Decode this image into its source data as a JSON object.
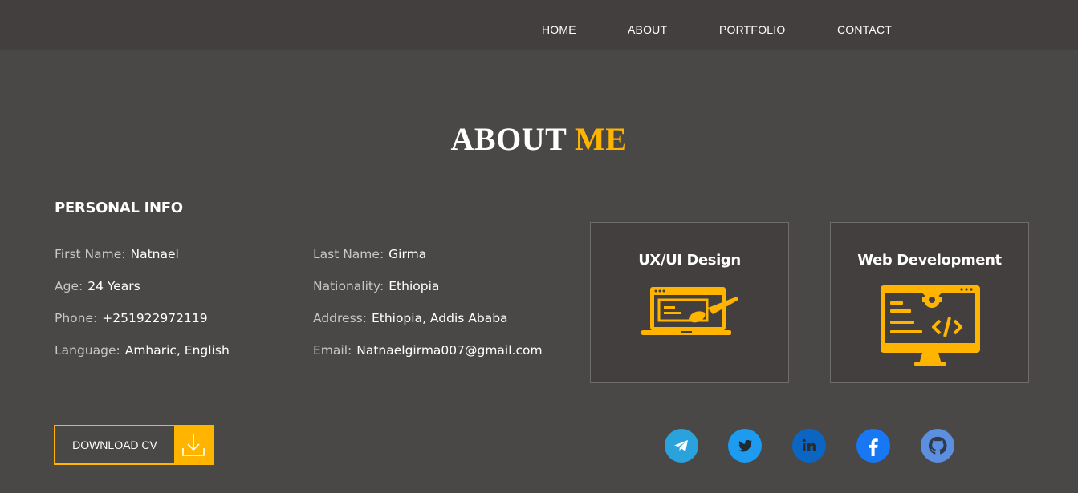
{
  "nav": {
    "items": [
      {
        "label": "HOME"
      },
      {
        "label": "ABOUT"
      },
      {
        "label": "PORTFOLIO"
      },
      {
        "label": "CONTACT"
      }
    ]
  },
  "about": {
    "title_main": "ABOUT",
    "title_accent": "ME",
    "personal_heading": "PERSONAL INFO",
    "info": [
      {
        "label": "First Name:",
        "value": "Natnael"
      },
      {
        "label": "Age:",
        "value": "24 Years"
      },
      {
        "label": "Phone:",
        "value": "+251922972119"
      },
      {
        "label": "Language:",
        "value": "Amharic, English"
      },
      {
        "label": "Last Name:",
        "value": "Girma"
      },
      {
        "label": "Nationality:",
        "value": "Ethiopia"
      },
      {
        "label": "Address:",
        "value": "Ethiopia, Addis Ababa"
      },
      {
        "label": "Email:",
        "value": "Natnaelgirma007@gmail.com"
      }
    ],
    "download_label": "DOWNLOAD CV"
  },
  "services": [
    {
      "title": "UX/UI Design",
      "icon": "design-laptop-icon"
    },
    {
      "title": "Web Development",
      "icon": "code-monitor-icon"
    }
  ],
  "social": [
    {
      "name": "telegram-icon",
      "color": "#2aa3dc"
    },
    {
      "name": "twitter-icon",
      "color": "#1d9bf0"
    },
    {
      "name": "linkedin-icon",
      "color": "#0a66c2"
    },
    {
      "name": "facebook-icon",
      "color": "#1877f2"
    },
    {
      "name": "github-icon",
      "color": "#5c8fe0"
    }
  ],
  "colors": {
    "background": "#4a4846",
    "navbar": "#423f3e",
    "accent": "#ffb400"
  }
}
